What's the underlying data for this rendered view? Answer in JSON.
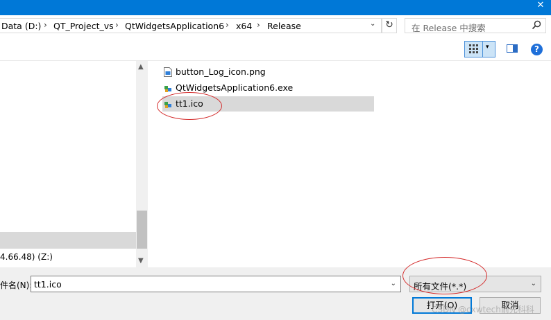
{
  "window": {
    "close_glyph": "✕"
  },
  "address_bar": {
    "crumbs": [
      "Data (D:)",
      "QT_Project_vs",
      "QtWidgetsApplication6",
      "x64",
      "Release"
    ],
    "separator": "›",
    "dropdown_glyph": "⌄",
    "refresh_glyph": "↻"
  },
  "search": {
    "placeholder": "在 Release 中搜索",
    "icon": "search-icon"
  },
  "toolbar": {
    "view_arrow": "▾",
    "help": "?"
  },
  "nav_pane": {
    "drive_label": "4.66.48) (Z:)",
    "scroll_up": "▲",
    "scroll_down": "▼"
  },
  "files": [
    {
      "name": "button_Log_icon.png",
      "icon": "png-file-icon",
      "selected": false
    },
    {
      "name": "QtWidgetsApplication6.exe",
      "icon": "exe-file-icon",
      "selected": false
    },
    {
      "name": "tt1.ico",
      "icon": "ico-file-icon",
      "selected": true
    }
  ],
  "bottom": {
    "filename_label": "件名(N):",
    "filename_value": "tt1.ico",
    "filter_value": "所有文件(*.*)",
    "open_label": "打开(O)",
    "cancel_label": "取消",
    "dropdown_glyph": "⌄"
  },
  "watermark": "CSDN @cxwtech前先科科",
  "colors": {
    "titlebar": "#0078d7",
    "selection": "#d9d9d9",
    "annotation": "#d42a2a",
    "accent": "#0078d7"
  }
}
